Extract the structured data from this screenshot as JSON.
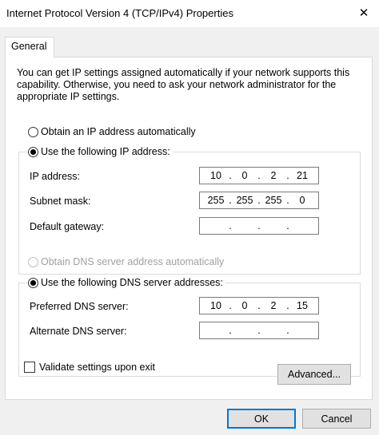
{
  "window": {
    "title": "Internet Protocol Version 4 (TCP/IPv4) Properties",
    "close_glyph": "✕"
  },
  "tabs": [
    {
      "label": "General"
    }
  ],
  "intro_text": "You can get IP settings assigned automatically if your network supports this capability. Otherwise, you need to ask your network administrator for the appropriate IP settings.",
  "ip_section": {
    "auto_label": "Obtain an IP address automatically",
    "manual_label": "Use the following IP address:",
    "selected": "manual",
    "fields": [
      {
        "label": "IP address:",
        "octets": [
          "10",
          "0",
          "2",
          "21"
        ]
      },
      {
        "label": "Subnet mask:",
        "octets": [
          "255",
          "255",
          "255",
          "0"
        ]
      },
      {
        "label": "Default gateway:",
        "octets": [
          "",
          "",
          "",
          ""
        ]
      }
    ]
  },
  "dns_section": {
    "auto_label": "Obtain DNS server address automatically",
    "auto_enabled": false,
    "manual_label": "Use the following DNS server addresses:",
    "selected": "manual",
    "fields": [
      {
        "label": "Preferred DNS server:",
        "octets": [
          "10",
          "0",
          "2",
          "15"
        ]
      },
      {
        "label": "Alternate DNS server:",
        "octets": [
          "",
          "",
          "",
          ""
        ]
      }
    ]
  },
  "validate": {
    "label": "Validate settings upon exit",
    "checked": false
  },
  "buttons": {
    "advanced": "Advanced...",
    "ok": "OK",
    "cancel": "Cancel"
  }
}
